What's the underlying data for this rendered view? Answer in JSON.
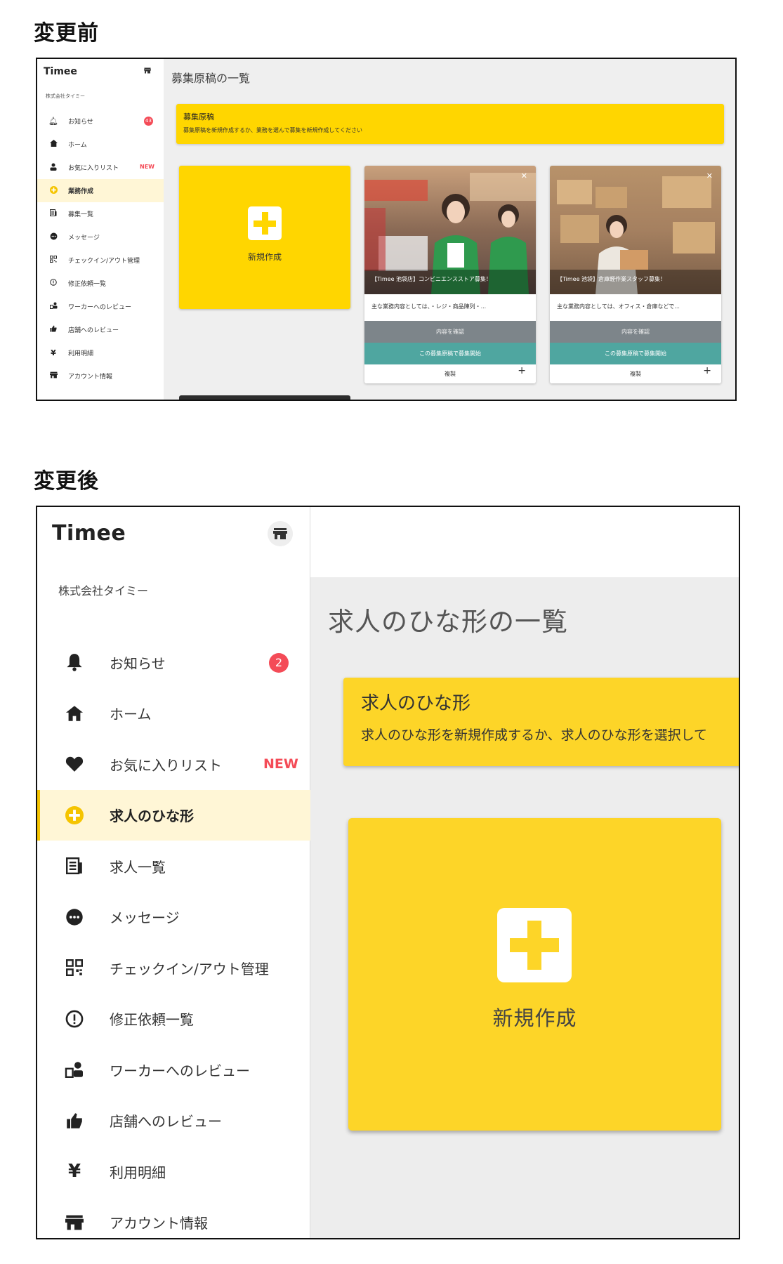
{
  "headings": {
    "before": "変更前",
    "after": "変更後"
  },
  "before": {
    "logo": "Timee",
    "company": "株式会社タイミー",
    "nav": [
      {
        "label": "お知らせ",
        "icon": "bell-icon",
        "badge": "43"
      },
      {
        "label": "ホーム",
        "icon": "home-icon"
      },
      {
        "label": "お気に入りリスト",
        "icon": "person-icon",
        "tag": "NEW"
      },
      {
        "label": "業務作成",
        "icon": "plus-circle-icon",
        "active": true
      },
      {
        "label": "募集一覧",
        "icon": "list-icon"
      },
      {
        "label": "メッセージ",
        "icon": "chat-icon"
      },
      {
        "label": "チェックイン/アウト管理",
        "icon": "qr-icon"
      },
      {
        "label": "修正依頼一覧",
        "icon": "alert-circle-icon"
      },
      {
        "label": "ワーカーへのレビュー",
        "icon": "worker-review-icon"
      },
      {
        "label": "店舗へのレビュー",
        "icon": "thumbs-up-icon"
      },
      {
        "label": "利用明細",
        "icon": "yen-icon"
      },
      {
        "label": "アカウント情報",
        "icon": "store-icon"
      }
    ],
    "page_title": "募集原稿の一覧",
    "banner": {
      "title": "募集原稿",
      "text": "募集原稿を新規作成するか、業務を選んで募集を新規作成してください"
    },
    "new_card_label": "新規作成",
    "cards": [
      {
        "caption": "【Timee 池袋店】コンビニエンスストア募集！",
        "description": "主な業務内容としては、・レジ・商品陳列・...",
        "check_label": "内容を確認",
        "start_label": "この募集原稿で募集開始",
        "copy_label": "複製"
      },
      {
        "caption": "【Timee 池袋】倉庫軽作業スタッフ募集！",
        "description": "主な業務内容としては、オフィス・倉庫などで...",
        "check_label": "内容を確認",
        "start_label": "この募集原稿で募集開始",
        "copy_label": "複製"
      }
    ]
  },
  "after": {
    "logo": "Timee",
    "company": "株式会社タイミー",
    "nav": [
      {
        "label": "お知らせ",
        "icon": "bell-icon",
        "badge": "2"
      },
      {
        "label": "ホーム",
        "icon": "home-icon"
      },
      {
        "label": "お気に入りリスト",
        "icon": "heart-icon",
        "tag": "NEW"
      },
      {
        "label": "求人のひな形",
        "icon": "plus-circle-icon",
        "active": true
      },
      {
        "label": "求人一覧",
        "icon": "list-icon"
      },
      {
        "label": "メッセージ",
        "icon": "chat-icon"
      },
      {
        "label": "チェックイン/アウト管理",
        "icon": "qr-icon"
      },
      {
        "label": "修正依頼一覧",
        "icon": "alert-circle-icon"
      },
      {
        "label": "ワーカーへのレビュー",
        "icon": "worker-review-icon"
      },
      {
        "label": "店舗へのレビュー",
        "icon": "thumbs-up-icon"
      },
      {
        "label": "利用明細",
        "icon": "yen-icon"
      },
      {
        "label": "アカウント情報",
        "icon": "store-icon"
      }
    ],
    "page_title": "求人のひな形の一覧",
    "banner": {
      "title": "求人のひな形",
      "text": "求人のひな形を新規作成するか、求人のひな形を選択して"
    },
    "new_card_label": "新規作成"
  },
  "colors": {
    "accent": "#fdd528",
    "badge": "#f44b57",
    "active_bg": "#fff6d6",
    "teal": "#4fa6a0",
    "gray_btn": "#7d858a"
  }
}
